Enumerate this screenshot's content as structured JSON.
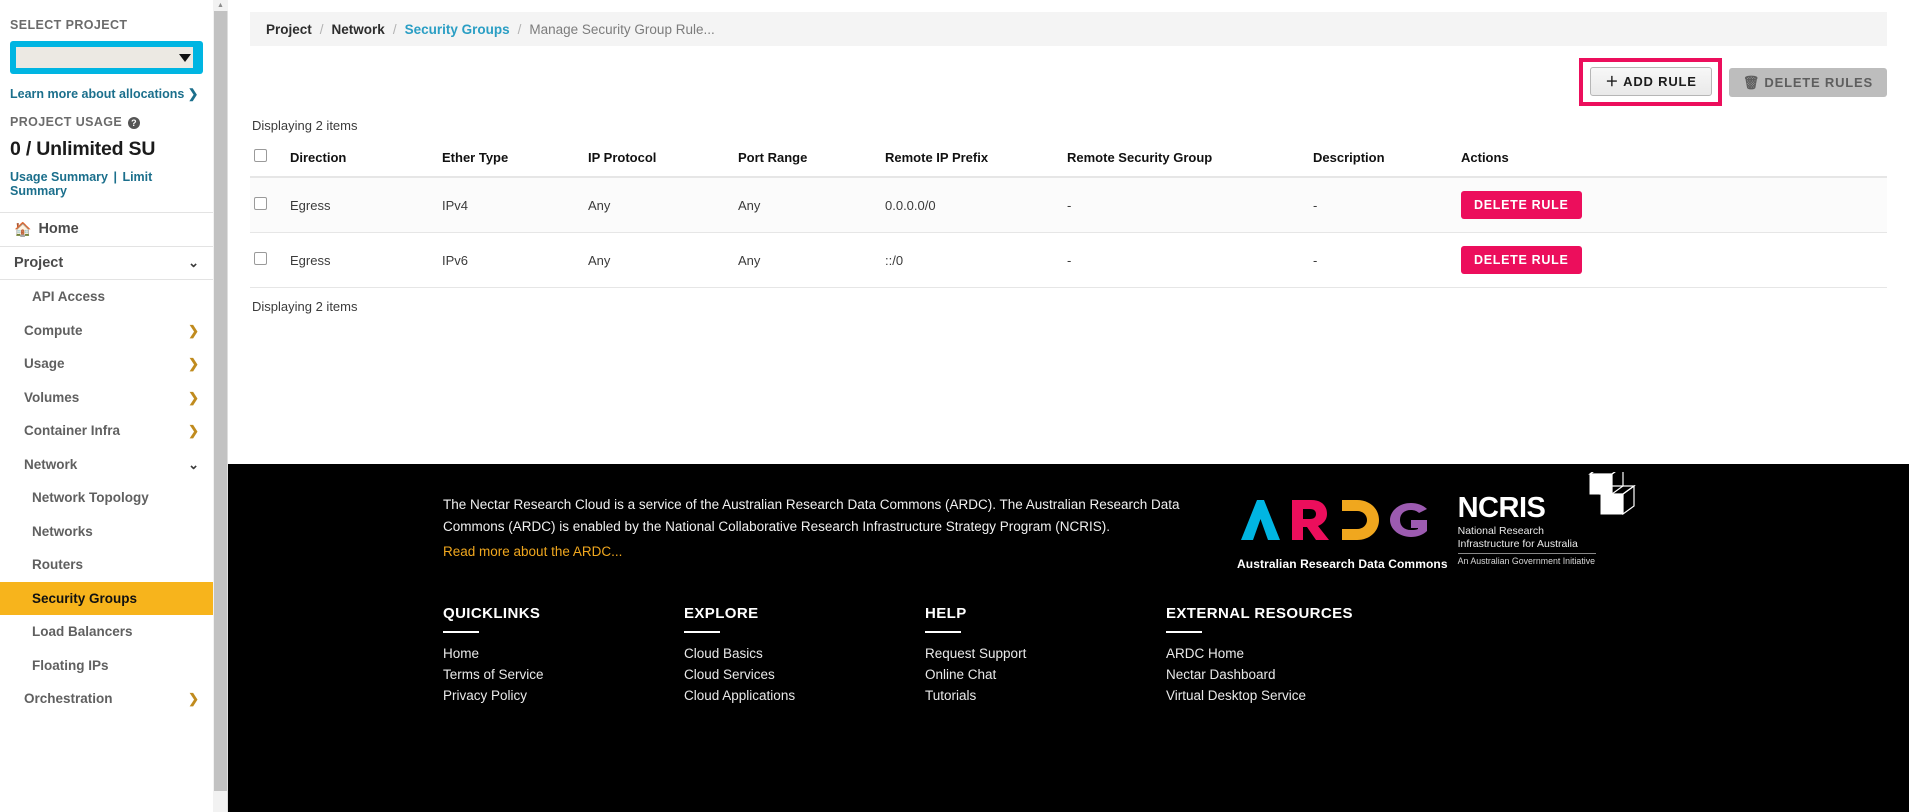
{
  "sidebar": {
    "select_project_label": "SELECT PROJECT",
    "project_select_value": "",
    "learn_more_label": "Learn more about allocations",
    "learn_more_chevron": "❯",
    "project_usage_label": "PROJECT USAGE",
    "help_badge": "?",
    "usage_amount": "0 / Unlimited SU",
    "usage_summary_label": "Usage Summary",
    "usage_sep": "|",
    "limit_summary_label": "Limit Summary",
    "home_label": "Home",
    "home_icon": "home-icon",
    "items": [
      {
        "label": "Project",
        "type": "group",
        "chevron": "⌄",
        "expanded": true
      },
      {
        "label": "API Access",
        "type": "child"
      },
      {
        "label": "Compute",
        "type": "sub",
        "chevron": "❯"
      },
      {
        "label": "Usage",
        "type": "sub",
        "chevron": "❯"
      },
      {
        "label": "Volumes",
        "type": "sub",
        "chevron": "❯"
      },
      {
        "label": "Container Infra",
        "type": "sub",
        "chevron": "❯"
      },
      {
        "label": "Network",
        "type": "sub",
        "chevron": "⌄",
        "expanded": true
      },
      {
        "label": "Network Topology",
        "type": "child"
      },
      {
        "label": "Networks",
        "type": "child"
      },
      {
        "label": "Routers",
        "type": "child"
      },
      {
        "label": "Security Groups",
        "type": "child",
        "active": true
      },
      {
        "label": "Load Balancers",
        "type": "child"
      },
      {
        "label": "Floating IPs",
        "type": "child"
      },
      {
        "label": "Orchestration",
        "type": "sub",
        "chevron": "❯"
      }
    ]
  },
  "breadcrumb": {
    "items": [
      "Project",
      "Network",
      "Security Groups",
      "Manage Security Group Rule..."
    ],
    "separator": "/"
  },
  "toolbar": {
    "add_rule_label": "＋ ADD RULE",
    "add_rule_highlight_color": "#ec0e5c",
    "delete_rules_label": "🗑 DELETE RULES"
  },
  "table": {
    "displaying_top": "Displaying 2 items",
    "displaying_bottom": "Displaying 2 items",
    "headers": [
      "",
      "Direction",
      "Ether Type",
      "IP Protocol",
      "Port Range",
      "Remote IP Prefix",
      "Remote Security Group",
      "Description",
      "Actions"
    ],
    "rows": [
      {
        "direction": "Egress",
        "ether_type": "IPv4",
        "ip_protocol": "Any",
        "port_range": "Any",
        "remote_ip_prefix": "0.0.0.0/0",
        "remote_security_group": "-",
        "description": "-",
        "action_label": "DELETE RULE"
      },
      {
        "direction": "Egress",
        "ether_type": "IPv6",
        "ip_protocol": "Any",
        "port_range": "Any",
        "remote_ip_prefix": "::/0",
        "remote_security_group": "-",
        "description": "-",
        "action_label": "DELETE RULE"
      }
    ],
    "delete_button_color": "#ec0e5c"
  },
  "footer": {
    "blurb": "The Nectar Research Cloud is a service of the Australian Research Data Commons (ARDC). The Australian Research Data Commons (ARDC) is enabled by the National Collaborative Research Infrastructure Strategy Program (NCRIS).",
    "blurb_link": "Read more about the ARDC...",
    "ardc_letters": [
      {
        "letter": "A",
        "color": "#00b5e2"
      },
      {
        "letter": "R",
        "color": "#ec0e5c"
      },
      {
        "letter": "D",
        "color": "#f0a71e"
      },
      {
        "letter": "C",
        "color": "#9c5bb0"
      }
    ],
    "ardc_caption": "Australian Research Data Commons",
    "ncris_word": "NCRIS",
    "ncris_sub": "National Research Infrastructure for Australia",
    "ncris_gov": "An Australian Government Initiative",
    "columns": [
      {
        "title": "QUICKLINKS",
        "links": [
          "Home",
          "Terms of Service",
          "Privacy Policy"
        ]
      },
      {
        "title": "EXPLORE",
        "links": [
          "Cloud Basics",
          "Cloud Services",
          "Cloud Applications"
        ]
      },
      {
        "title": "HELP",
        "links": [
          "Request Support",
          "Online Chat",
          "Tutorials"
        ]
      },
      {
        "title": "EXTERNAL RESOURCES",
        "links": [
          "ARDC Home",
          "Nectar Dashboard",
          "Virtual Desktop Service"
        ]
      }
    ]
  }
}
